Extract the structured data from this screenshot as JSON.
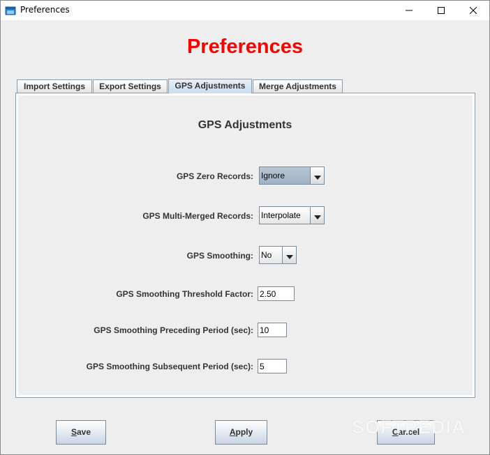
{
  "window": {
    "title": "Preferences"
  },
  "heading": "Preferences",
  "tabs": [
    {
      "label": "Import Settings",
      "active": false
    },
    {
      "label": "Export Settings",
      "active": false
    },
    {
      "label": "GPS Adjustments",
      "active": true
    },
    {
      "label": "Merge Adjustments",
      "active": false
    }
  ],
  "panel": {
    "title": "GPS Adjustments",
    "zero_records": {
      "label": "GPS Zero Records:",
      "value": "Ignore"
    },
    "multi_merged": {
      "label": "GPS Multi-Merged Records:",
      "value": "Interpolate"
    },
    "smoothing": {
      "label": "GPS Smoothing:",
      "value": "No"
    },
    "threshold": {
      "label": "GPS Smoothing Threshold Factor:",
      "value": "2.50"
    },
    "preceding": {
      "label": "GPS Smoothing Preceding Period (sec):",
      "value": "10"
    },
    "subsequent": {
      "label": "GPS Smoothing Subsequent Period (sec):",
      "value": "5"
    }
  },
  "buttons": {
    "save": {
      "mnemonic": "S",
      "rest": "ave"
    },
    "apply": {
      "mnemonic": "A",
      "rest": "pply"
    },
    "cancel": {
      "mnemonic": "C",
      "rest": "ancel"
    }
  },
  "watermark": "SOFTPEDIA",
  "colors": {
    "heading": "#ff0000",
    "tab_active": "#c9dcee",
    "selected_combo": "#b8c6d4",
    "border": "#7a8a99"
  },
  "icons": {
    "app": "window-app-icon",
    "minimize": "minimize-icon",
    "maximize": "maximize-icon",
    "close": "close-icon",
    "dropdown": "triangle-down-icon"
  }
}
